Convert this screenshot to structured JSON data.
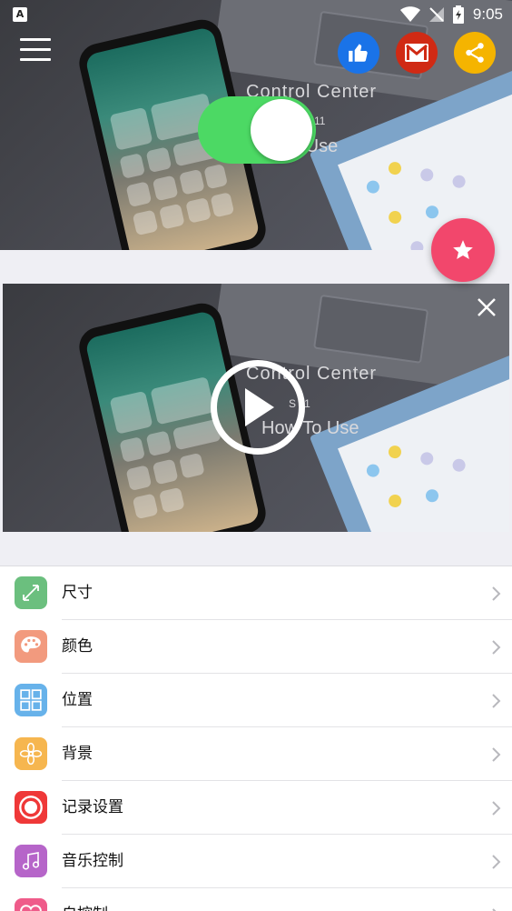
{
  "status_bar": {
    "time": "9:05",
    "app_badge": "A"
  },
  "hero": {
    "caption_line1": "Control Center",
    "caption_line2": "11",
    "caption_line3": "o Use",
    "toggle_on": true
  },
  "video": {
    "caption_line1": "Control Center",
    "caption_line2": "S 11",
    "caption_line3": "How To Use"
  },
  "colors": {
    "toggle_green": "#4cd964",
    "fab_pink": "#f2476c",
    "like_blue": "#1a73e8",
    "mail_red": "#d02a14",
    "share_yellow": "#f5b400"
  },
  "menu": {
    "items": [
      {
        "label": "尺寸",
        "icon": "resize-icon",
        "color": "#6bbf7e"
      },
      {
        "label": "颜色",
        "icon": "palette-icon",
        "color": "#f29a7e"
      },
      {
        "label": "位置",
        "icon": "grid-icon",
        "color": "#67b2ea"
      },
      {
        "label": "背景",
        "icon": "flower-icon",
        "color": "#f6b64f"
      },
      {
        "label": "记录设置",
        "icon": "record-icon",
        "color": "#ef3838"
      },
      {
        "label": "音乐控制",
        "icon": "music-icon",
        "color": "#b665c9"
      },
      {
        "label": "自控制",
        "icon": "heart-icon",
        "color": "#ef5b8a"
      }
    ]
  }
}
